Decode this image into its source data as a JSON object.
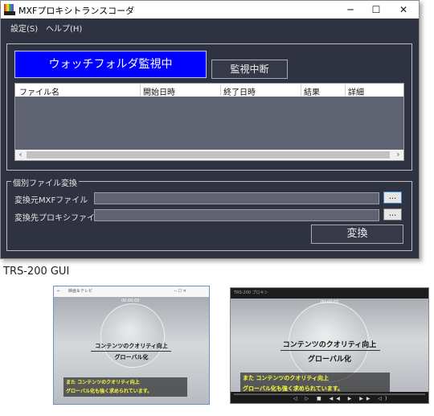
{
  "window": {
    "title": "MXFプロキシトランスコーダ",
    "minimize": "─",
    "maximize": "☐",
    "close": "✕"
  },
  "menu": [
    "設定(S)",
    "ヘルプ(H)"
  ],
  "watch": {
    "status": "ウォッチフォルダ監視中",
    "stop_label": "監視中断"
  },
  "grid": {
    "columns": [
      "ファイル名",
      "開始日時",
      "終了日時",
      "結果",
      "詳細"
    ]
  },
  "convert": {
    "group_label": "個別ファイル変換",
    "source_label": "変換元MXFファイル",
    "source_value": "",
    "dest_label": "変換先プロキシファイル",
    "dest_value": "",
    "browse": "...",
    "button": "変換"
  },
  "caption": "TRS-200 GUI",
  "preview_small": {
    "window_title": "映画＆テレビ",
    "timecode": "00:00:05",
    "headline1": "コンテンツのクオリティ向上",
    "headline2": "グローバル化",
    "subtitle1": "また コンテンツのクオリティ向上",
    "subtitle2": "グローバル化も強く求められています。"
  },
  "preview_large": {
    "window_title": "TRS-200 プロキシ",
    "timecode": "00:00:05",
    "headline1": "コンテンツのクオリティ向上",
    "headline2": "グローバル化",
    "subtitle1": "また コンテンツのクオリティ向上",
    "subtitle2": "グローバル化も強く求められています。",
    "controls": "◁ ▷ ■ ◀◀ ▶ ▶▶ ◁)"
  },
  "colors": {
    "window_bg": "#2f3240",
    "watch_status_bg": "#0000ff",
    "subtitle_text": "#ffff33"
  }
}
